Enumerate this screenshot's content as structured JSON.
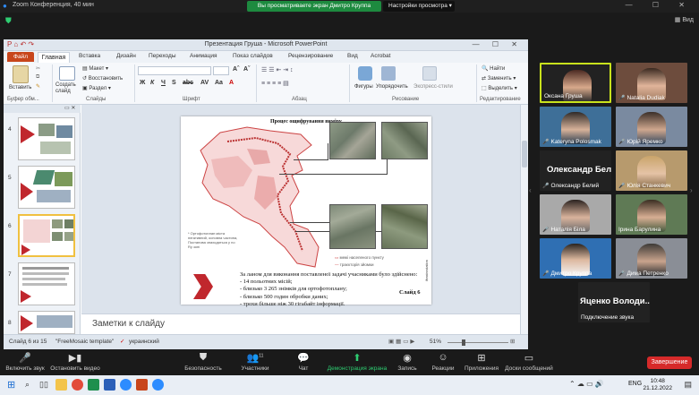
{
  "zoom": {
    "title": "Zoom Конференция, 40 мин",
    "share_banner": "Вы просматриваете экран Дмитро Круппа",
    "view_options": "Настройки просмотра ▾",
    "view_label": "Вид",
    "window_controls": "— ☐ ✕"
  },
  "ppt": {
    "title": "Презентация Груша - Microsoft PowerPoint",
    "qat": "P ⌂ ↶ ↷",
    "window_controls": "— ☐ ✕",
    "tabs": [
      "Файл",
      "Главная",
      "Вставка",
      "Дизайн",
      "Переходы",
      "Анимация",
      "Показ слайдов",
      "Рецензирование",
      "Вид",
      "Acrobat"
    ],
    "ribbon": {
      "paste": "Вставить",
      "clipboard": "Буфер обм...",
      "create_slide": "Создать слайд",
      "layout": "Макет ▾",
      "reset": "Восстановить",
      "section": "Раздел ▾",
      "slides": "Слайды",
      "font": "Шрифт",
      "paragraph": "Абзац",
      "shapes": "Фигуры",
      "arrange": "Упорядочить",
      "express_styles": "Экспресс-стили",
      "drawing": "Рисование",
      "find": "Найти",
      "replace": "Заменить ▾",
      "select": "Выделить ▾",
      "editing": "Редактирование"
    },
    "panel_tabs": "▭  ✕",
    "thumb_numbers": [
      "4",
      "5",
      "6",
      "7",
      "8"
    ],
    "slide": {
      "title": "Процес ощифрування виміру",
      "legend_border": "межі населеного пункту",
      "legend_track": "траєкторія зйомки",
      "map_note": "* Ортофотоплан міста негативний, основна частина, Постанова знаходяться у no Ry зоні",
      "body_lines": [
        "За ланом для виконання поставленої задачі учасниками було здійснено:",
        "- 14 польотних місій;",
        "- близько 3 265 знімків для ортофотоплану;",
        "- близько 500 годин обробки даних;",
        "- трохи більше ніж 30 гігабайт інформації."
      ],
      "slide_label": "Слайд 6",
      "side_tag": "ifrastrostation"
    },
    "notes_placeholder": "Заметки к слайду",
    "status": {
      "slide_of": "Слайд 6 из 15",
      "theme": "\"FreeMosaic template\"",
      "language": "украинский",
      "zoom": "51%"
    }
  },
  "participants": [
    {
      "name": "Оксана Груша",
      "active": true,
      "muted": false,
      "video": true
    },
    {
      "name": "Natalia Dudiak",
      "active": false,
      "muted": true,
      "video": true
    },
    {
      "name": "Kateryna Polosmak",
      "active": false,
      "muted": true,
      "video": true
    },
    {
      "name": "Юрій Яремко",
      "active": false,
      "muted": true,
      "video": true
    },
    {
      "name": "Олександр Белий",
      "big": "Олександр Бел...",
      "active": false,
      "muted": true,
      "video": false
    },
    {
      "name": "Юлія Станкевич",
      "active": false,
      "muted": true,
      "video": true
    },
    {
      "name": "Наталія Біла",
      "active": false,
      "muted": true,
      "video": true
    },
    {
      "name": "Ірина Барулина",
      "active": false,
      "muted": false,
      "video": true
    },
    {
      "name": "Дмитро Круппа",
      "active": false,
      "muted": true,
      "video": true
    },
    {
      "name": "Дима Петренко",
      "active": false,
      "muted": true,
      "video": true
    },
    {
      "name": "Подключение звука",
      "big": "Яценко Володи...",
      "active": false,
      "muted": false,
      "video": false
    }
  ],
  "toolbar": {
    "audio": "Включить звук",
    "video": "Остановить видео",
    "security": "Безопасность",
    "participants": "Участники",
    "participants_count": "11",
    "chat": "Чат",
    "share": "Демонстрация экрана",
    "record": "Запись",
    "reactions": "Реакции",
    "apps": "Приложения",
    "whiteboards": "Доски сообщений",
    "end": "Завершение"
  },
  "taskbar": {
    "lang": "ENG",
    "time": "10:48",
    "date": "21.12.2022"
  },
  "colors": {
    "zoom_green": "#1d8a3f",
    "ppt_file_tab": "#c8461c",
    "end_red": "#d62a2a",
    "active_speaker": "#c9e21c"
  }
}
